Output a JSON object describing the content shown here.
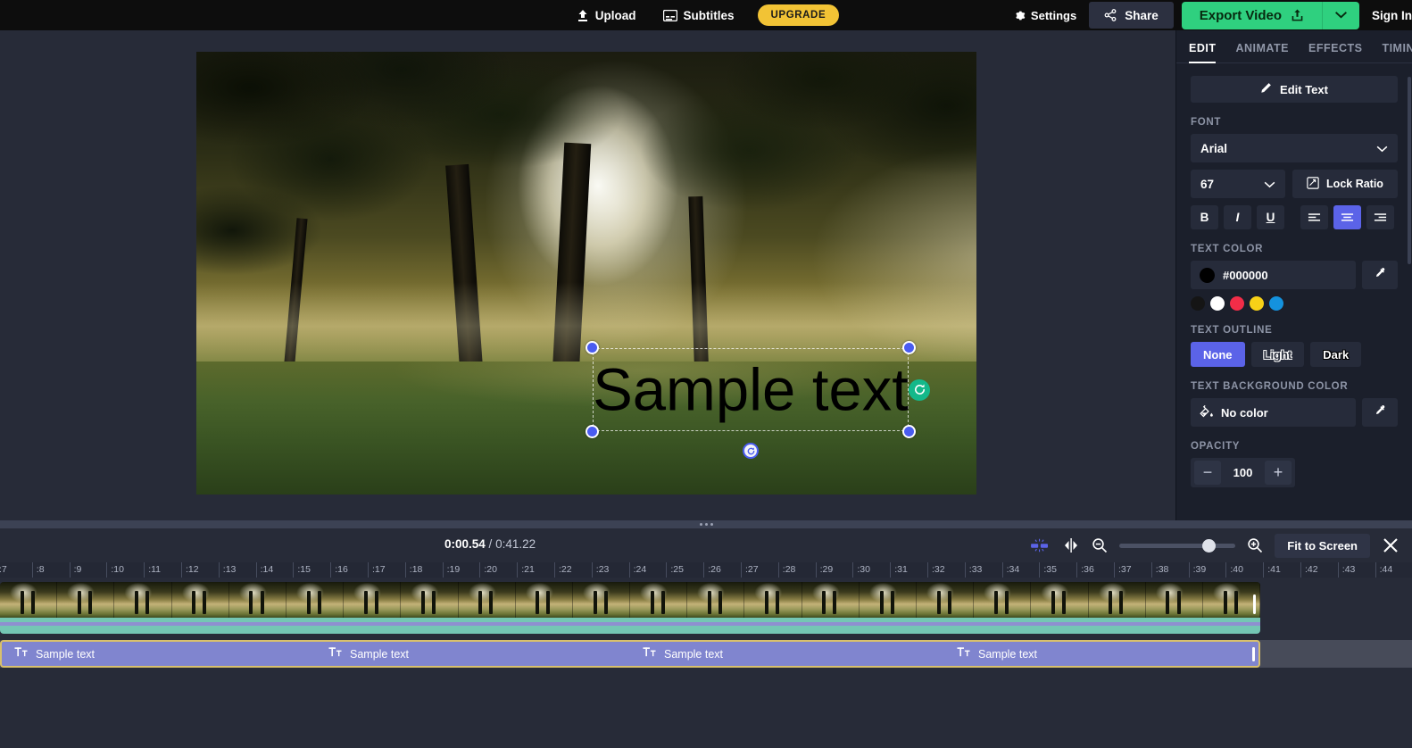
{
  "topbar": {
    "upload_label": "Upload",
    "upload_icon": "upload-icon",
    "subtitles_label": "Subtitles",
    "subtitles_icon": "subtitles-icon",
    "upgrade_label": "UPGRADE",
    "settings_label": "Settings",
    "settings_icon": "gear-icon",
    "share_label": "Share",
    "share_icon": "share-icon",
    "export_label": "Export Video",
    "export_icon": "export-upload-icon",
    "export_caret_icon": "chevron-down-icon",
    "signin_label": "Sign In",
    "upgrade_color": "#f2c335",
    "export_color": "#2fd07f"
  },
  "canvas": {
    "text_value": "Sample text",
    "rotate_icon": "rotate-icon",
    "rotate_handle_icon": "rotate-handle-icon"
  },
  "panel": {
    "tabs": [
      {
        "label": "EDIT",
        "active": true
      },
      {
        "label": "ANIMATE",
        "active": false
      },
      {
        "label": "EFFECTS",
        "active": false
      },
      {
        "label": "TIMING",
        "active": false
      }
    ],
    "edit_text_label": "Edit Text",
    "edit_text_icon": "pencil-icon",
    "font_section_label": "FONT",
    "font_family_value": "Arial",
    "font_size_value": "67",
    "lock_ratio_label": "Lock Ratio",
    "lock_ratio_icon": "lock-ratio-icon",
    "style_buttons": [
      {
        "label": "B",
        "name": "bold-button",
        "selected": false
      },
      {
        "label": "I",
        "name": "italic-button",
        "selected": false
      },
      {
        "label": "U",
        "name": "underline-button",
        "selected": false
      }
    ],
    "align_buttons": [
      {
        "name": "align-left-button",
        "selected": false
      },
      {
        "name": "align-center-button",
        "selected": true
      },
      {
        "name": "align-right-button",
        "selected": false
      }
    ],
    "text_color_label": "TEXT COLOR",
    "text_color_value": "#000000",
    "eyedropper_icon": "eyedropper-icon",
    "swatches": [
      "#151515",
      "#ffffff",
      "#f22d48",
      "#f7d117",
      "#1492de"
    ],
    "text_outline_label": "TEXT OUTLINE",
    "outline_options": [
      {
        "label": "None",
        "selected": true
      },
      {
        "label": "Light",
        "selected": false
      },
      {
        "label": "Dark",
        "selected": false
      }
    ],
    "text_bg_label": "TEXT BACKGROUND COLOR",
    "text_bg_value": "No color",
    "text_bg_icon": "paint-bucket-icon",
    "opacity_label": "OPACITY",
    "opacity_value": "100",
    "minus_label": "−",
    "plus_label": "+",
    "accent_color": "#5b63e8"
  },
  "timeline": {
    "current_time": "0:00.54",
    "total_time": "0:41.22",
    "time_separator": " / ",
    "snap_icon": "snap-magnet-icon",
    "split_icon": "split-clip-icon",
    "zoom_out_icon": "zoom-out-icon",
    "zoom_in_icon": "zoom-in-icon",
    "fit_screen_label": "Fit to Screen",
    "close_icon": "close-icon",
    "ruler_ticks": [
      ":7",
      ":8",
      ":9",
      ":10",
      ":11",
      ":12",
      ":13",
      ":14",
      ":15",
      ":16",
      ":17",
      ":18",
      ":19",
      ":20",
      ":21",
      ":22",
      ":23",
      ":24",
      ":25",
      ":26",
      ":27",
      ":28",
      ":29",
      ":30",
      ":31",
      ":32",
      ":33",
      ":34",
      ":35",
      ":36",
      ":37",
      ":38",
      ":39",
      ":40",
      ":41",
      ":42",
      ":43",
      ":44"
    ],
    "text_clips": [
      {
        "label": "Sample text",
        "icon": "text-clip-icon"
      },
      {
        "label": "Sample text",
        "icon": "text-clip-icon"
      },
      {
        "label": "Sample text",
        "icon": "text-clip-icon"
      },
      {
        "label": "Sample text",
        "icon": "text-clip-icon"
      }
    ]
  }
}
